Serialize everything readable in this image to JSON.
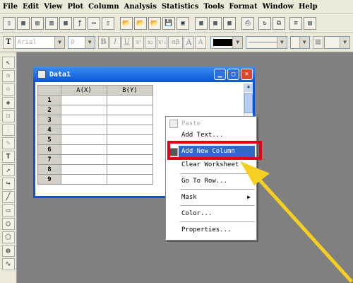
{
  "menubar": {
    "items": [
      "File",
      "Edit",
      "View",
      "Plot",
      "Column",
      "Analysis",
      "Statistics",
      "Tools",
      "Format",
      "Window",
      "Help"
    ]
  },
  "format_toolbar": {
    "font_name": "Arial",
    "font_size": "0",
    "bold": "B",
    "italic": "I",
    "underline": "U",
    "superscript": "x²",
    "subscript": "x₂",
    "supersub": "x¹₂",
    "greek": "αβ",
    "increase": "A",
    "decrease": "A"
  },
  "worksheet": {
    "title": "Data1",
    "columns": [
      "A(X)",
      "B(Y)"
    ],
    "rows": [
      "1",
      "2",
      "3",
      "4",
      "5",
      "6",
      "7",
      "8",
      "9"
    ]
  },
  "context_menu": {
    "items": [
      {
        "label": "Paste",
        "disabled": true
      },
      {
        "label": "Add Text...",
        "disabled": false
      },
      {
        "label": "Add New Column",
        "highlighted": true
      },
      {
        "label": "Clear Worksheet",
        "disabled": false
      },
      {
        "label": "Go To Row...",
        "disabled": false
      },
      {
        "label": "Mask",
        "submenu": true
      },
      {
        "label": "Color...",
        "disabled": false
      },
      {
        "label": "Properties...",
        "disabled": false
      }
    ]
  },
  "colors": {
    "highlight": "#316ac5",
    "annotation_box": "#e0001a",
    "annotation_arrow": "#f5d020"
  }
}
